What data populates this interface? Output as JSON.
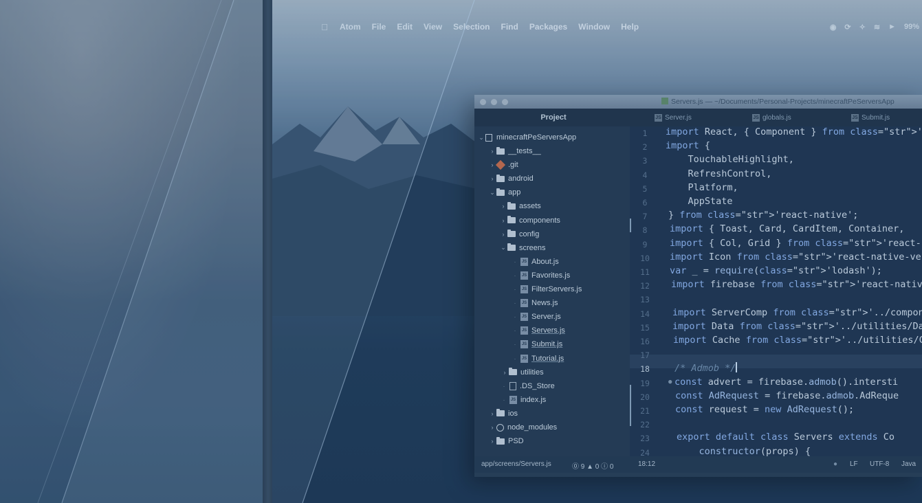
{
  "menubar": {
    "apple_icon": "apple-icon",
    "items": [
      "Atom",
      "File",
      "Edit",
      "View",
      "Selection",
      "Find",
      "Packages",
      "Window",
      "Help"
    ],
    "battery": "99%"
  },
  "window": {
    "title": "Servers.js — ~/Documents/Personal-Projects/minecraftPeServersApp"
  },
  "tabs": {
    "project": "Project",
    "files": [
      "Server.js",
      "globals.js",
      "Submit.js"
    ]
  },
  "tree": {
    "root": "minecraftPeServersApp",
    "items": [
      {
        "label": "__tests__",
        "kind": "folder",
        "arrow": ">"
      },
      {
        "label": ".git",
        "kind": "git",
        "arrow": ">"
      },
      {
        "label": "android",
        "kind": "folder",
        "arrow": ">"
      },
      {
        "label": "app",
        "kind": "folder",
        "arrow": "v"
      },
      {
        "label": "assets",
        "kind": "folder",
        "arrow": ">"
      },
      {
        "label": "components",
        "kind": "folder",
        "arrow": ">"
      },
      {
        "label": "config",
        "kind": "folder",
        "arrow": ">"
      },
      {
        "label": "screens",
        "kind": "folder",
        "arrow": "v"
      },
      {
        "label": "About.js",
        "kind": "file"
      },
      {
        "label": "Favorites.js",
        "kind": "file"
      },
      {
        "label": "FilterServers.js",
        "kind": "file"
      },
      {
        "label": "News.js",
        "kind": "file"
      },
      {
        "label": "Server.js",
        "kind": "file"
      },
      {
        "label": "Servers.js",
        "kind": "file"
      },
      {
        "label": "Submit.js",
        "kind": "file"
      },
      {
        "label": "Tutorial.js",
        "kind": "file"
      },
      {
        "label": "utilities",
        "kind": "folder",
        "arrow": ">"
      },
      {
        "label": ".DS_Store",
        "kind": "ds"
      },
      {
        "label": "index.js",
        "kind": "file"
      },
      {
        "label": "ios",
        "kind": "folder",
        "arrow": ">"
      },
      {
        "label": "node_modules",
        "kind": "node",
        "arrow": ">"
      },
      {
        "label": "PSD",
        "kind": "folder",
        "arrow": ">"
      }
    ]
  },
  "editor": {
    "line_numbers": [
      "1",
      "2",
      "3",
      "4",
      "5",
      "6",
      "7",
      "8",
      "9",
      "10",
      "11",
      "12",
      "13",
      "14",
      "15",
      "16",
      "17",
      "18",
      "19",
      "20",
      "21",
      "22",
      "23",
      "24"
    ],
    "current_line": "18",
    "lines": [
      "import React, { Component } from 'react';",
      "import {",
      "    TouchableHighlight,",
      "    RefreshControl,",
      "    Platform,",
      "    AppState",
      "} from 'react-native';",
      "import { Toast, Card, CardItem, Container,",
      "import { Col, Grid } from 'react-native-ea",
      "import Icon from 'react-native-vector-icon",
      "var _ = require('lodash');",
      "import firebase from 'react-native-fireba",
      "",
      "import ServerComp from '../components/Ser",
      "import Data from '../utilities/Data';",
      "import Cache from '../utilities/Cache';",
      "",
      "/* Admob */",
      "const advert = firebase.admob().intersti",
      "const AdRequest = firebase.admob.AdReque",
      "const request = new AdRequest();",
      "",
      "export default class Servers extends Co",
      "    constructor(props) {"
    ]
  },
  "statusbar": {
    "path": "app/screens/Servers.js",
    "diagnostics": "⓪ 9 ▲ 0 ⓘ 0",
    "cursor": "18:12",
    "dot": "●",
    "eol": "LF",
    "encoding": "UTF-8",
    "grammar": "Java"
  }
}
